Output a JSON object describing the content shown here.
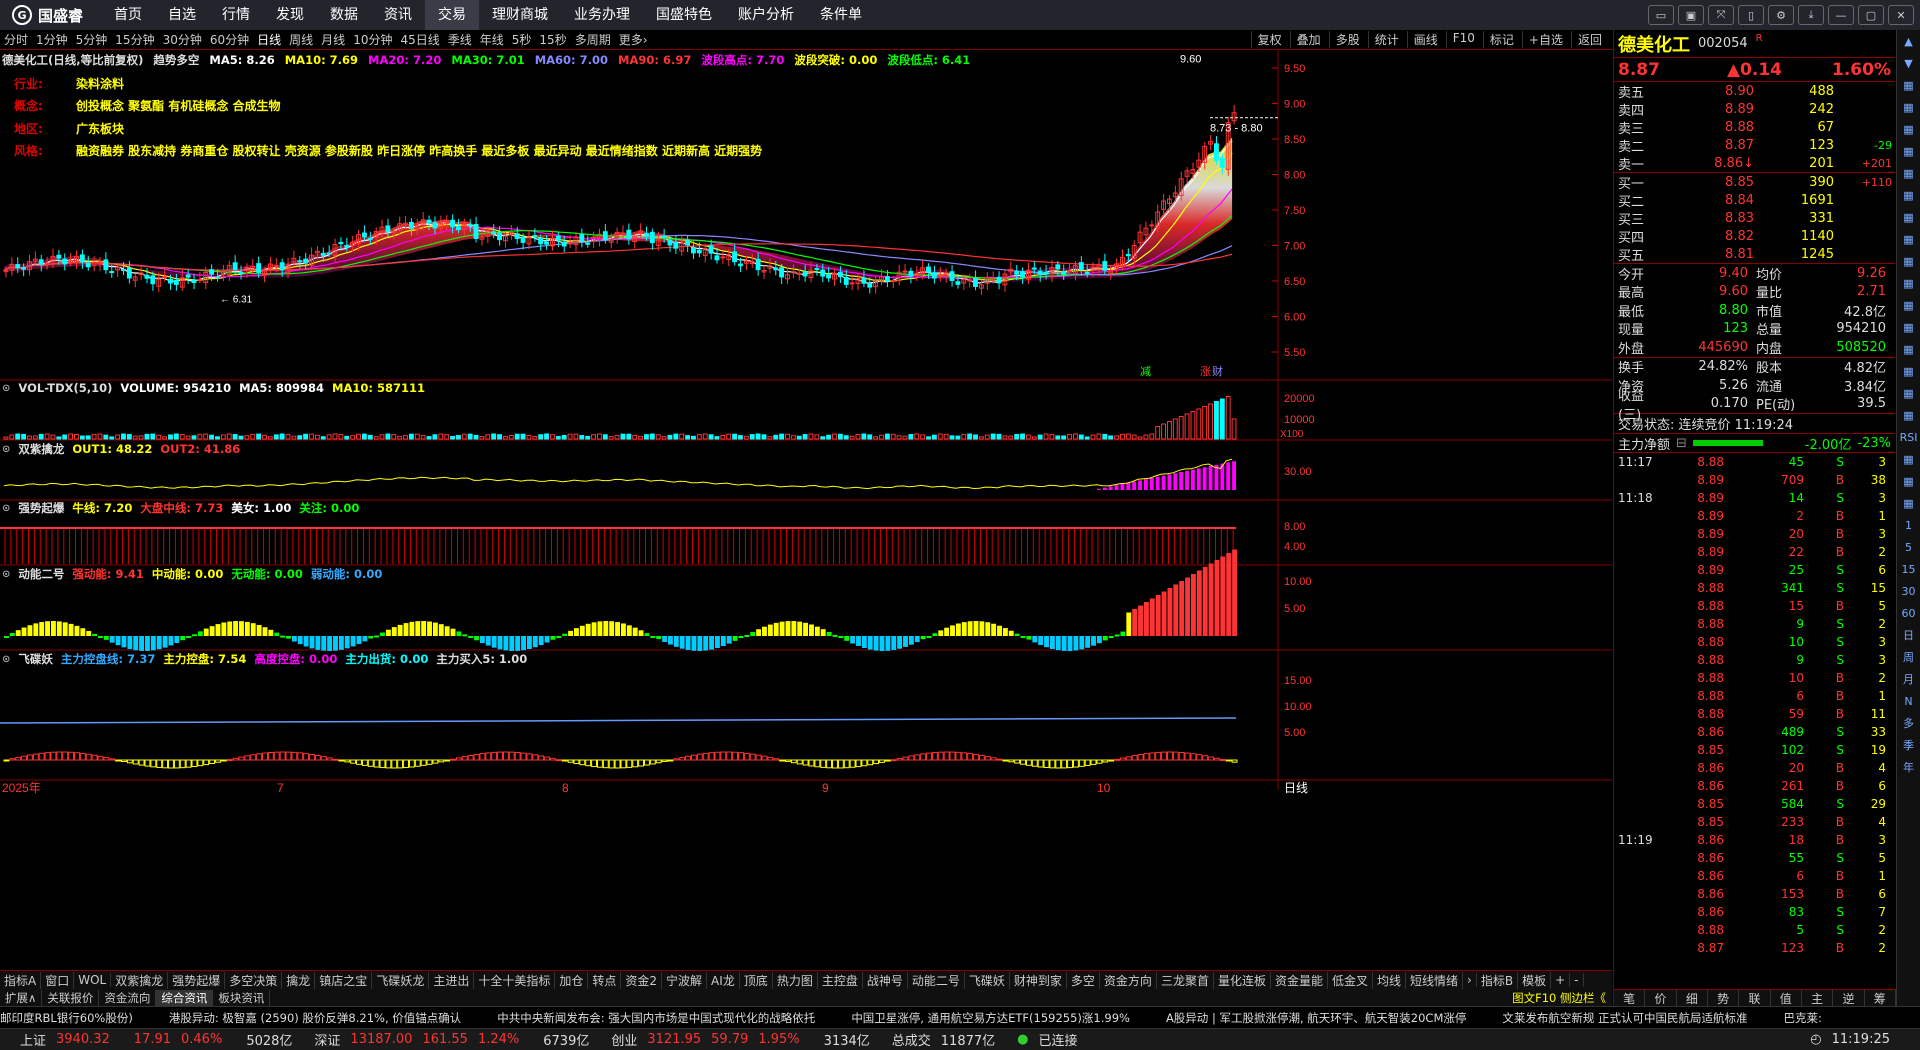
{
  "app": {
    "logo_text": "国盛睿"
  },
  "topmenu": [
    "首页",
    "自选",
    "行情",
    "发现",
    "数据",
    "资讯",
    "交易",
    "理财商城",
    "业务办理",
    "国盛特色",
    "账户分析",
    "条件单"
  ],
  "topmenu_active": "交易",
  "window_buttons": [
    "▭",
    "▣",
    "⤧",
    "▯",
    "⚙",
    "⤓",
    "—",
    "▢",
    "✕"
  ],
  "periods": [
    "分时",
    "1分钟",
    "5分钟",
    "15分钟",
    "30分钟",
    "60分钟",
    "日线",
    "周线",
    "月线",
    "10分钟",
    "45日线",
    "季线",
    "年线",
    "5秒",
    "15秒",
    "多周期",
    "更多›"
  ],
  "period_active": "日线",
  "chart_tools": [
    "复权",
    "叠加",
    "多股",
    "统计",
    "画线",
    "F10",
    "标记",
    "+自选",
    "返回"
  ],
  "ma_line": [
    {
      "text": "德美化工(日线,等比前复权)",
      "color": "#dddddd"
    },
    {
      "text": "趋势多空",
      "color": "#dddddd"
    },
    {
      "text": "MA5: 8.26",
      "color": "#ffffff"
    },
    {
      "text": "MA10: 7.69",
      "color": "#ffff00"
    },
    {
      "text": "MA20: 7.20",
      "color": "#ff00ff"
    },
    {
      "text": "MA30: 7.01",
      "color": "#00ff00"
    },
    {
      "text": "MA60: 7.00",
      "color": "#8888ff"
    },
    {
      "text": "MA90: 6.97",
      "color": "#ff3333"
    },
    {
      "text": "波段高点: 7.70",
      "color": "#ff00ff"
    },
    {
      "text": "波段突破: 0.00",
      "color": "#ffff00"
    },
    {
      "text": "波段低点: 6.41",
      "color": "#00ff00"
    }
  ],
  "info": [
    {
      "k": "行业:",
      "v": "染料涂料"
    },
    {
      "k": "概念:",
      "v": "创投概念 聚氨酯 有机硅概念 合成生物"
    },
    {
      "k": "地区:",
      "v": "广东板块"
    },
    {
      "k": "风格:",
      "v": "融资融券 股东减持 券商重仓 股权转让 壳资源 参股新股 昨日涨停 昨高换手 最近多板 最近异动 最近情绪指数 近期新高 近期强势"
    }
  ],
  "price_axis": [
    "9.50",
    "9.00",
    "8.50",
    "8.00",
    "7.50",
    "7.00",
    "6.50",
    "6.00",
    "5.50"
  ],
  "main_annotations": {
    "high_label": "9.60",
    "range_label": "8.73 - 8.80",
    "low_label": "6.31",
    "tag_a": "减",
    "tag_b": "涨",
    "tag_c": "财"
  },
  "vol_header": [
    {
      "text": "VOL-TDX(5,10)",
      "color": "#dddddd"
    },
    {
      "text": "VOLUME: 954210",
      "color": "#ffffff"
    },
    {
      "text": "MA5: 809984",
      "color": "#ffffff"
    },
    {
      "text": "MA10: 587111",
      "color": "#ffff00"
    }
  ],
  "vol_axis": [
    "20000",
    "10000"
  ],
  "vol_unit": "X100",
  "p2_header": [
    {
      "text": "双紫擒龙",
      "color": "#dddddd"
    },
    {
      "text": "OUT1: 48.22",
      "color": "#ffff00"
    },
    {
      "text": "OUT2: 41.86",
      "color": "#ff3333"
    }
  ],
  "p2_axis": [
    "30.00"
  ],
  "p3_header": [
    {
      "text": "强势起爆",
      "color": "#dddddd"
    },
    {
      "text": "牛线: 7.20",
      "color": "#ffff00"
    },
    {
      "text": "大盘中线: 7.73",
      "color": "#ff3333"
    },
    {
      "text": "美女: 1.00",
      "color": "#ffffff"
    },
    {
      "text": "关注: 0.00",
      "color": "#00ff00"
    }
  ],
  "p3_axis": [
    "8.00",
    "4.00"
  ],
  "p4_header": [
    {
      "text": "动能二号",
      "color": "#dddddd"
    },
    {
      "text": "强动能: 9.41",
      "color": "#ff3333"
    },
    {
      "text": "中动能: 0.00",
      "color": "#ffff00"
    },
    {
      "text": "无动能: 0.00",
      "color": "#00ff00"
    },
    {
      "text": "弱动能: 0.00",
      "color": "#33aaff"
    }
  ],
  "p4_axis": [
    "10.00",
    "5.00"
  ],
  "p5_header": [
    {
      "text": "飞碟妖",
      "color": "#dddddd"
    },
    {
      "text": "主力控盘线: 7.37",
      "color": "#33aaff"
    },
    {
      "text": "主力控盘: 7.54",
      "color": "#ffff00"
    },
    {
      "text": "高度控盘: 0.00",
      "color": "#ff00ff"
    },
    {
      "text": "主力出货: 0.00",
      "color": "#00ffff"
    },
    {
      "text": "主力买入5: 1.00",
      "color": "#dddddd"
    }
  ],
  "p5_axis": [
    "15.00",
    "10.00",
    "5.00"
  ],
  "x_axis": {
    "year": "2025年",
    "m7": "7",
    "m8": "8",
    "m9": "9",
    "m10": "10",
    "period_label": "日线"
  },
  "bottom_tabs": [
    "指标A",
    "窗口",
    "WOL",
    "双紫擒龙",
    "强势起爆",
    "多空决策",
    "擒龙",
    "镇店之宝",
    "飞碟妖龙",
    "主进出",
    "十全十美指标",
    "加仓",
    "转点",
    "资金2",
    "宁波解",
    "AI龙",
    "顶底",
    "热力图",
    "主控盘",
    "战神号",
    "动能二号",
    "飞碟妖",
    "财神到家",
    "多空",
    "资金方向",
    "三龙聚首",
    "量化连板",
    "资金量能",
    "低金叉",
    "均线",
    "短线情绪",
    "›",
    "指标B",
    "模板",
    "+",
    "-"
  ],
  "bottom_tabs2": [
    "扩展∧",
    "关联报价",
    "资金流向",
    "综合资讯",
    "板块资讯"
  ],
  "bottom_tabs2_active": "综合资讯",
  "f10_link": "图文F10 侧边栏《",
  "ticker_items": [
    "邮印度RBL银行60%股份)",
    "港股异动: 极智嘉 (2590) 股价反弹8.21%, 价值锚点确认",
    "中共中央新闻发布会: 强大国内市场是中国式现代化的战略依托",
    "中国卫星涨停, 通用航空易方达ETF(159255)涨1.99%",
    "A股异动 | 军工股掀涨停潮, 航天环宇、航天智装20CM涨停",
    "文莱发布航空新规 正式认可中国民航局适航标准",
    "巴克莱:"
  ],
  "status": {
    "sh_label": "上证",
    "sh_val": "3940.32",
    "sh_chg": "17.91",
    "sh_pct": "0.46%",
    "sh_amt": "5028亿",
    "sz_label": "深证",
    "sz_val": "13187.00",
    "sz_chg": "161.55",
    "sz_pct": "1.24%",
    "sz_amt": "6739亿",
    "cy_label": "创业",
    "cy_val": "3121.95",
    "cy_chg": "59.79",
    "cy_pct": "1.95%",
    "cy_amt": "3134亿",
    "total_label": "总成交",
    "total_amt": "11877亿",
    "conn": "已连接",
    "time": "11:19:25"
  },
  "quote": {
    "name": "德美化工",
    "code": "002054",
    "r": "R",
    "price": "8.87",
    "change": "▲0.14",
    "pct": "1.60%",
    "asks": [
      [
        "卖五",
        "8.90",
        "488",
        ""
      ],
      [
        "卖四",
        "8.89",
        "242",
        ""
      ],
      [
        "卖三",
        "8.88",
        "67",
        ""
      ],
      [
        "卖二",
        "8.87",
        "123",
        "-29"
      ],
      [
        "卖一",
        "8.86↓",
        "201",
        "+201"
      ]
    ],
    "bids": [
      [
        "买一",
        "8.85",
        "390",
        "+110"
      ],
      [
        "买二",
        "8.84",
        "1691",
        ""
      ],
      [
        "买三",
        "8.83",
        "331",
        ""
      ],
      [
        "买四",
        "8.82",
        "1140",
        ""
      ],
      [
        "买五",
        "8.81",
        "1245",
        ""
      ]
    ],
    "stats": [
      [
        "今开",
        "9.40",
        "均价",
        "9.26"
      ],
      [
        "最高",
        "9.60",
        "量比",
        "2.71"
      ],
      [
        "最低",
        "8.80",
        "市值",
        "42.8亿"
      ],
      [
        "现量",
        "123",
        "总量",
        "954210"
      ],
      [
        "外盘",
        "445690",
        "内盘",
        "508520"
      ]
    ],
    "stats2": [
      [
        "换手",
        "24.82%",
        "股本",
        "4.82亿"
      ],
      [
        "净资",
        "5.26",
        "流通",
        "3.84亿"
      ],
      [
        "收益(三)",
        "0.170",
        "PE(动)",
        "39.5"
      ]
    ],
    "trade_state": "交易状态: 连续竞价 11:19:24",
    "net_label": "主力净额",
    "net_val": "-2.00亿",
    "net_pct": "-23%"
  },
  "ticks": [
    [
      "11:17",
      "8.88",
      "45",
      "S",
      "3"
    ],
    [
      "",
      "8.89",
      "709",
      "B",
      "38"
    ],
    [
      "11:18",
      "8.89",
      "14",
      "S",
      "3"
    ],
    [
      "",
      "8.89",
      "2",
      "B",
      "1"
    ],
    [
      "",
      "8.89",
      "20",
      "B",
      "3"
    ],
    [
      "",
      "8.89",
      "22",
      "B",
      "2"
    ],
    [
      "",
      "8.89",
      "25",
      "S",
      "6"
    ],
    [
      "",
      "8.88",
      "341",
      "S",
      "15"
    ],
    [
      "",
      "8.88",
      "15",
      "B",
      "5"
    ],
    [
      "",
      "8.88",
      "9",
      "S",
      "2"
    ],
    [
      "",
      "8.88",
      "10",
      "S",
      "3"
    ],
    [
      "",
      "8.88",
      "9",
      "S",
      "3"
    ],
    [
      "",
      "8.88",
      "10",
      "B",
      "2"
    ],
    [
      "",
      "8.88",
      "6",
      "B",
      "1"
    ],
    [
      "",
      "8.88",
      "59",
      "B",
      "11"
    ],
    [
      "",
      "8.86",
      "489",
      "S",
      "33"
    ],
    [
      "",
      "8.85",
      "102",
      "S",
      "19"
    ],
    [
      "",
      "8.86",
      "20",
      "B",
      "4"
    ],
    [
      "",
      "8.86",
      "261",
      "B",
      "6"
    ],
    [
      "",
      "8.85",
      "584",
      "S",
      "29"
    ],
    [
      "",
      "8.85",
      "233",
      "B",
      "4"
    ],
    [
      "11:19",
      "8.86",
      "18",
      "B",
      "3"
    ],
    [
      "",
      "8.86",
      "55",
      "S",
      "5"
    ],
    [
      "",
      "8.86",
      "6",
      "B",
      "1"
    ],
    [
      "",
      "8.86",
      "153",
      "B",
      "6"
    ],
    [
      "",
      "8.86",
      "83",
      "S",
      "7"
    ],
    [
      "",
      "8.88",
      "5",
      "S",
      "2"
    ],
    [
      "",
      "8.87",
      "123",
      "B",
      "2"
    ]
  ],
  "rp_bottom": [
    "笔",
    "价",
    "细",
    "势",
    "联",
    "值",
    "主",
    "逆",
    "筹"
  ],
  "sidebar_icons": [
    "▲",
    "▼",
    "▦",
    "▦",
    "▦",
    "▦",
    "▦",
    "▦",
    "▦",
    "▦",
    "▦",
    "▦",
    "▦",
    "▦",
    "▦",
    "▦",
    "▦",
    "▦",
    "RSI",
    "▦",
    "▦",
    "▦",
    "1",
    "5",
    "15",
    "30",
    "60",
    "日",
    "周",
    "月",
    "N",
    "多",
    "季",
    "年"
  ],
  "colors": {
    "up": "#ff3333",
    "down": "#00ffff",
    "accent_red": "#880000",
    "yellow": "#ffff00"
  }
}
